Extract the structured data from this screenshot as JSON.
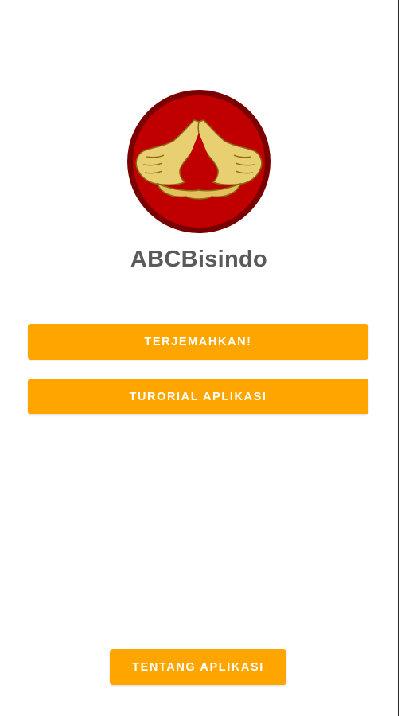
{
  "app": {
    "title": "ABCBisindo"
  },
  "buttons": {
    "translate_label": "TERJEMAHKAN!",
    "tutorial_label": "TURORIAL APLIKASI",
    "about_label": "TENTANG APLIKASI"
  },
  "colors": {
    "accent": "#FFA500",
    "logo_red": "#C00000",
    "logo_ring": "#7A0000",
    "title_text": "#5A5A5A",
    "background": "#FFFFFF"
  },
  "icons": {
    "logo": "sign-language-hands-logo"
  }
}
